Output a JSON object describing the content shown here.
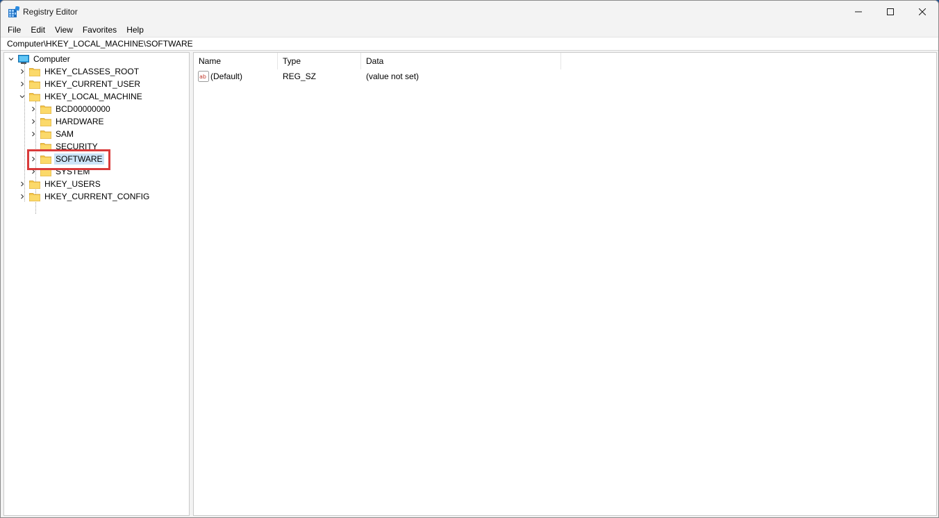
{
  "window": {
    "title": "Registry Editor"
  },
  "menubar": {
    "items": [
      {
        "label": "File"
      },
      {
        "label": "Edit"
      },
      {
        "label": "View"
      },
      {
        "label": "Favorites"
      },
      {
        "label": "Help"
      }
    ]
  },
  "address": {
    "path": "Computer\\HKEY_LOCAL_MACHINE\\SOFTWARE"
  },
  "tree": {
    "root": "Computer",
    "hkcr": "HKEY_CLASSES_ROOT",
    "hkcu": "HKEY_CURRENT_USER",
    "hklm": "HKEY_LOCAL_MACHINE",
    "hklm_children": {
      "bcd": "BCD00000000",
      "hardware": "HARDWARE",
      "sam": "SAM",
      "security": "SECURITY",
      "software": "SOFTWARE",
      "system": "SYSTEM"
    },
    "hku": "HKEY_USERS",
    "hkcc": "HKEY_CURRENT_CONFIG",
    "selected": "SOFTWARE"
  },
  "list": {
    "columns": {
      "name": "Name",
      "type": "Type",
      "data": "Data"
    },
    "rows": [
      {
        "name": "(Default)",
        "type": "REG_SZ",
        "data": "(value not set)",
        "icon": "string-value-icon"
      }
    ]
  },
  "colors": {
    "selection": "#cce4f7",
    "highlight_box": "#d93b3b",
    "folder": "#f6c94d"
  }
}
